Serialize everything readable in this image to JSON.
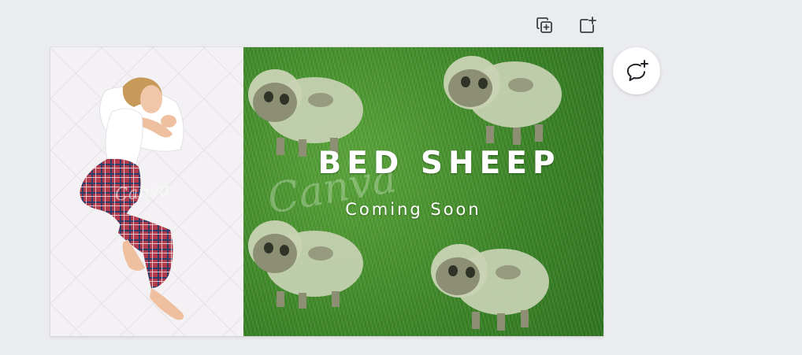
{
  "page_toolbar": {
    "duplicate_icon": "duplicate-page-icon",
    "add_icon": "add-page-icon"
  },
  "design": {
    "title": "BED SHEEP",
    "subtitle": "Coming Soon",
    "watermark": "Canva",
    "colors": {
      "grass": "#3f8c2a",
      "sheep": "#c9d3b4",
      "text": "#ffffff",
      "pajama": "#b23a4a"
    }
  },
  "comment_button": {
    "icon": "add-comment-icon"
  }
}
